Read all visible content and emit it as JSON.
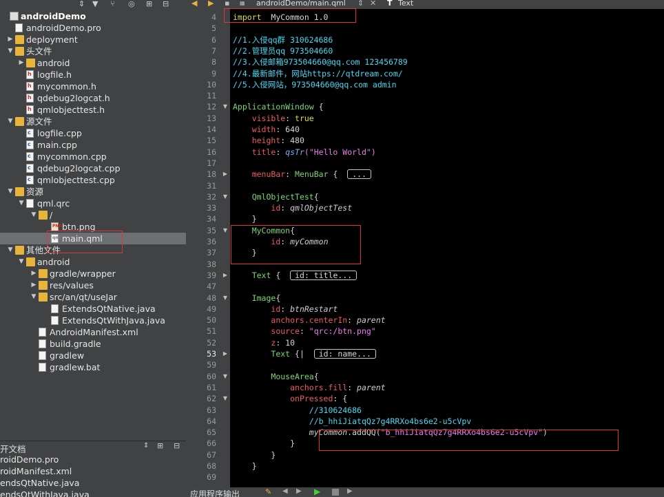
{
  "tree": [
    {
      "label": "androidDemo",
      "icon": "project-icon",
      "indent": 0,
      "arrow": "",
      "bold": true
    },
    {
      "label": "androidDemo.pro",
      "icon": "pro-file-icon",
      "indent": 1,
      "arrow": ""
    },
    {
      "label": "deployment",
      "icon": "folder-icon",
      "indent": 1,
      "arrow": "▶"
    },
    {
      "label": "头文件",
      "icon": "header-folder-icon",
      "indent": 1,
      "arrow": "▼"
    },
    {
      "label": "android",
      "icon": "folder-icon",
      "indent": 2,
      "arrow": "▶"
    },
    {
      "label": "logfile.h",
      "icon": "h-file-icon",
      "indent": 2,
      "arrow": ""
    },
    {
      "label": "mycommon.h",
      "icon": "h-file-icon",
      "indent": 2,
      "arrow": ""
    },
    {
      "label": "qdebug2logcat.h",
      "icon": "h-file-icon",
      "indent": 2,
      "arrow": ""
    },
    {
      "label": "qmlobjecttest.h",
      "icon": "h-file-icon",
      "indent": 2,
      "arrow": ""
    },
    {
      "label": "源文件",
      "icon": "source-folder-icon",
      "indent": 1,
      "arrow": "▼"
    },
    {
      "label": "logfile.cpp",
      "icon": "cpp-file-icon",
      "indent": 2,
      "arrow": ""
    },
    {
      "label": "main.cpp",
      "icon": "cpp-file-icon",
      "indent": 2,
      "arrow": ""
    },
    {
      "label": "mycommon.cpp",
      "icon": "cpp-file-icon",
      "indent": 2,
      "arrow": ""
    },
    {
      "label": "qdebug2logcat.cpp",
      "icon": "cpp-file-icon",
      "indent": 2,
      "arrow": ""
    },
    {
      "label": "qmlobjecttest.cpp",
      "icon": "cpp-file-icon",
      "indent": 2,
      "arrow": ""
    },
    {
      "label": "资源",
      "icon": "resource-folder-icon",
      "indent": 1,
      "arrow": "▼"
    },
    {
      "label": "qml.qrc",
      "icon": "qrc-file-icon",
      "indent": 2,
      "arrow": "▼"
    },
    {
      "label": "/",
      "icon": "folder-icon",
      "indent": 3,
      "arrow": "▼"
    },
    {
      "label": "btn.png",
      "icon": "png-file-icon",
      "indent": 4,
      "arrow": ""
    },
    {
      "label": "main.qml",
      "icon": "qml-file-icon",
      "indent": 4,
      "arrow": "",
      "selected": true
    },
    {
      "label": "其他文件",
      "icon": "other-folder-icon",
      "indent": 1,
      "arrow": "▼"
    },
    {
      "label": "android",
      "icon": "folder-icon",
      "indent": 2,
      "arrow": "▼"
    },
    {
      "label": "gradle/wrapper",
      "icon": "folder-icon",
      "indent": 3,
      "arrow": "▶"
    },
    {
      "label": "res/values",
      "icon": "folder-icon",
      "indent": 3,
      "arrow": "▶"
    },
    {
      "label": "src/an/qt/useJar",
      "icon": "folder-icon",
      "indent": 3,
      "arrow": "▼"
    },
    {
      "label": "ExtendsQtNative.java",
      "icon": "java-file-icon",
      "indent": 4,
      "arrow": ""
    },
    {
      "label": "ExtendsQtWithJava.java",
      "icon": "java-file-icon",
      "indent": 4,
      "arrow": ""
    },
    {
      "label": "AndroidManifest.xml",
      "icon": "xml-file-icon",
      "indent": 3,
      "arrow": ""
    },
    {
      "label": "build.gradle",
      "icon": "gradle-file-icon",
      "indent": 3,
      "arrow": ""
    },
    {
      "label": "gradlew",
      "icon": "file-icon",
      "indent": 3,
      "arrow": ""
    },
    {
      "label": "gradlew.bat",
      "icon": "bat-file-icon",
      "indent": 3,
      "arrow": ""
    }
  ],
  "open_docs": {
    "title": "开文档",
    "items": [
      "roidDemo.pro",
      "roidManifest.xml",
      "endsQtNative.java",
      "endsQtWithJava.java"
    ]
  },
  "tab": {
    "file": "androidDemo/main.qml",
    "text_tab": "Text"
  },
  "bottom": {
    "output_label": "应用程序输出"
  },
  "lines": [
    {
      "n": "4",
      "tokens": [
        [
          "kw",
          "import"
        ],
        [
          "",
          "  MyCommon 1.0"
        ]
      ]
    },
    {
      "n": "5",
      "tokens": []
    },
    {
      "n": "6",
      "tokens": [
        [
          "cm",
          "//1.入侵qq群 310624686"
        ]
      ]
    },
    {
      "n": "7",
      "tokens": [
        [
          "cm",
          "//2.管理员qq 973504660"
        ]
      ]
    },
    {
      "n": "8",
      "tokens": [
        [
          "cm",
          "//3.入侵邮箱973504660@qq.com 123456789"
        ]
      ]
    },
    {
      "n": "9",
      "tokens": [
        [
          "cm",
          "//4.最新邮件，网站https://qtdream.com/"
        ]
      ]
    },
    {
      "n": "10",
      "tokens": [
        [
          "cm",
          "//5.入侵网站，973504660@qq.com admin"
        ]
      ]
    },
    {
      "n": "11",
      "tokens": []
    },
    {
      "n": "12",
      "fold": "▼",
      "tokens": [
        [
          "ty",
          "ApplicationWindow"
        ],
        [
          "",
          " {"
        ]
      ]
    },
    {
      "n": "13",
      "tokens": [
        [
          "",
          "    "
        ],
        [
          "pr",
          "visible"
        ],
        [
          "",
          ": "
        ],
        [
          "kw",
          "true"
        ]
      ]
    },
    {
      "n": "14",
      "tokens": [
        [
          "",
          "    "
        ],
        [
          "pr",
          "width"
        ],
        [
          "",
          ": 640"
        ]
      ]
    },
    {
      "n": "15",
      "tokens": [
        [
          "",
          "    "
        ],
        [
          "pr",
          "height"
        ],
        [
          "",
          ": 480"
        ]
      ]
    },
    {
      "n": "16",
      "tokens": [
        [
          "",
          "    "
        ],
        [
          "pr",
          "title"
        ],
        [
          "",
          ": "
        ],
        [
          "fn",
          "qsTr"
        ],
        [
          "st",
          "(\"Hello World\")"
        ]
      ]
    },
    {
      "n": "17",
      "tokens": []
    },
    {
      "n": "18",
      "fold": "▶",
      "tokens": [
        [
          "",
          "    "
        ],
        [
          "pr",
          "menuBar"
        ],
        [
          "",
          ": "
        ],
        [
          "ty",
          "MenuBar"
        ],
        [
          "",
          " {  "
        ],
        [
          "coll",
          "..."
        ]
      ]
    },
    {
      "n": "31",
      "tokens": []
    },
    {
      "n": "32",
      "fold": "▼",
      "tokens": [
        [
          "",
          "    "
        ],
        [
          "ty",
          "QmlObjectTest"
        ],
        [
          "",
          "{"
        ]
      ]
    },
    {
      "n": "33",
      "tokens": [
        [
          "",
          "        "
        ],
        [
          "pr",
          "id"
        ],
        [
          "",
          ": "
        ],
        [
          "it",
          "qmlObjectTest"
        ]
      ]
    },
    {
      "n": "34",
      "tokens": [
        [
          "",
          "    }"
        ]
      ]
    },
    {
      "n": "35",
      "fold": "▼",
      "tokens": [
        [
          "",
          "    "
        ],
        [
          "ty",
          "MyCommon"
        ],
        [
          "",
          "{"
        ]
      ]
    },
    {
      "n": "36",
      "tokens": [
        [
          "",
          "        "
        ],
        [
          "pr",
          "id"
        ],
        [
          "",
          ": "
        ],
        [
          "it",
          "myCommon"
        ]
      ]
    },
    {
      "n": "37",
      "tokens": [
        [
          "",
          "    }"
        ]
      ]
    },
    {
      "n": "38",
      "tokens": []
    },
    {
      "n": "39",
      "fold": "▶",
      "tokens": [
        [
          "",
          "    "
        ],
        [
          "ty",
          "Text"
        ],
        [
          "",
          " {  "
        ],
        [
          "coll",
          "id: title..."
        ]
      ]
    },
    {
      "n": "47",
      "tokens": []
    },
    {
      "n": "48",
      "fold": "▼",
      "tokens": [
        [
          "",
          "    "
        ],
        [
          "ty",
          "Image"
        ],
        [
          "",
          "{"
        ]
      ]
    },
    {
      "n": "49",
      "tokens": [
        [
          "",
          "        "
        ],
        [
          "pr",
          "id"
        ],
        [
          "",
          ": "
        ],
        [
          "it",
          "btnRestart"
        ]
      ]
    },
    {
      "n": "50",
      "tokens": [
        [
          "",
          "        "
        ],
        [
          "pr",
          "anchors.centerIn"
        ],
        [
          "",
          ": "
        ],
        [
          "it",
          "parent"
        ]
      ]
    },
    {
      "n": "51",
      "tokens": [
        [
          "",
          "        "
        ],
        [
          "pr",
          "source"
        ],
        [
          "",
          ": "
        ],
        [
          "st",
          "\"qrc:/btn.png\""
        ]
      ]
    },
    {
      "n": "52",
      "tokens": [
        [
          "",
          "        "
        ],
        [
          "pr",
          "z"
        ],
        [
          "",
          ": 10"
        ]
      ]
    },
    {
      "n": "53",
      "fold": "▶",
      "cur": true,
      "tokens": [
        [
          "",
          "        "
        ],
        [
          "ty",
          "Text"
        ],
        [
          "",
          " {|  "
        ],
        [
          "coll",
          "id: name..."
        ]
      ]
    },
    {
      "n": "59",
      "tokens": []
    },
    {
      "n": "60",
      "fold": "▼",
      "tokens": [
        [
          "",
          "        "
        ],
        [
          "ty",
          "MouseArea"
        ],
        [
          "",
          "{"
        ]
      ]
    },
    {
      "n": "61",
      "tokens": [
        [
          "",
          "            "
        ],
        [
          "pr",
          "anchors.fill"
        ],
        [
          "",
          ": "
        ],
        [
          "it",
          "parent"
        ]
      ]
    },
    {
      "n": "62",
      "fold": "▼",
      "tokens": [
        [
          "",
          "            "
        ],
        [
          "pr",
          "onPressed"
        ],
        [
          "",
          ": {"
        ]
      ]
    },
    {
      "n": "63",
      "tokens": [
        [
          "",
          "                "
        ],
        [
          "cm",
          "//310624686"
        ]
      ]
    },
    {
      "n": "64",
      "tokens": [
        [
          "",
          "                "
        ],
        [
          "cm",
          "//b_hhiJiatqQz7g4RRXo4bs6e2-u5cVpv"
        ]
      ]
    },
    {
      "n": "65",
      "tokens": [
        [
          "",
          "                "
        ],
        [
          "it",
          "myCommon"
        ],
        [
          "",
          ".addQQ("
        ],
        [
          "st",
          "\"b_hhiJiatqQz7g4RRXo4bs6e2-u5cVpv\""
        ],
        [
          "",
          ")"
        ]
      ]
    },
    {
      "n": "66",
      "tokens": [
        [
          "",
          "            }"
        ]
      ]
    },
    {
      "n": "67",
      "tokens": [
        [
          "",
          "        }"
        ]
      ]
    },
    {
      "n": "68",
      "tokens": [
        [
          "",
          "    }"
        ]
      ]
    },
    {
      "n": "69",
      "tokens": []
    }
  ]
}
